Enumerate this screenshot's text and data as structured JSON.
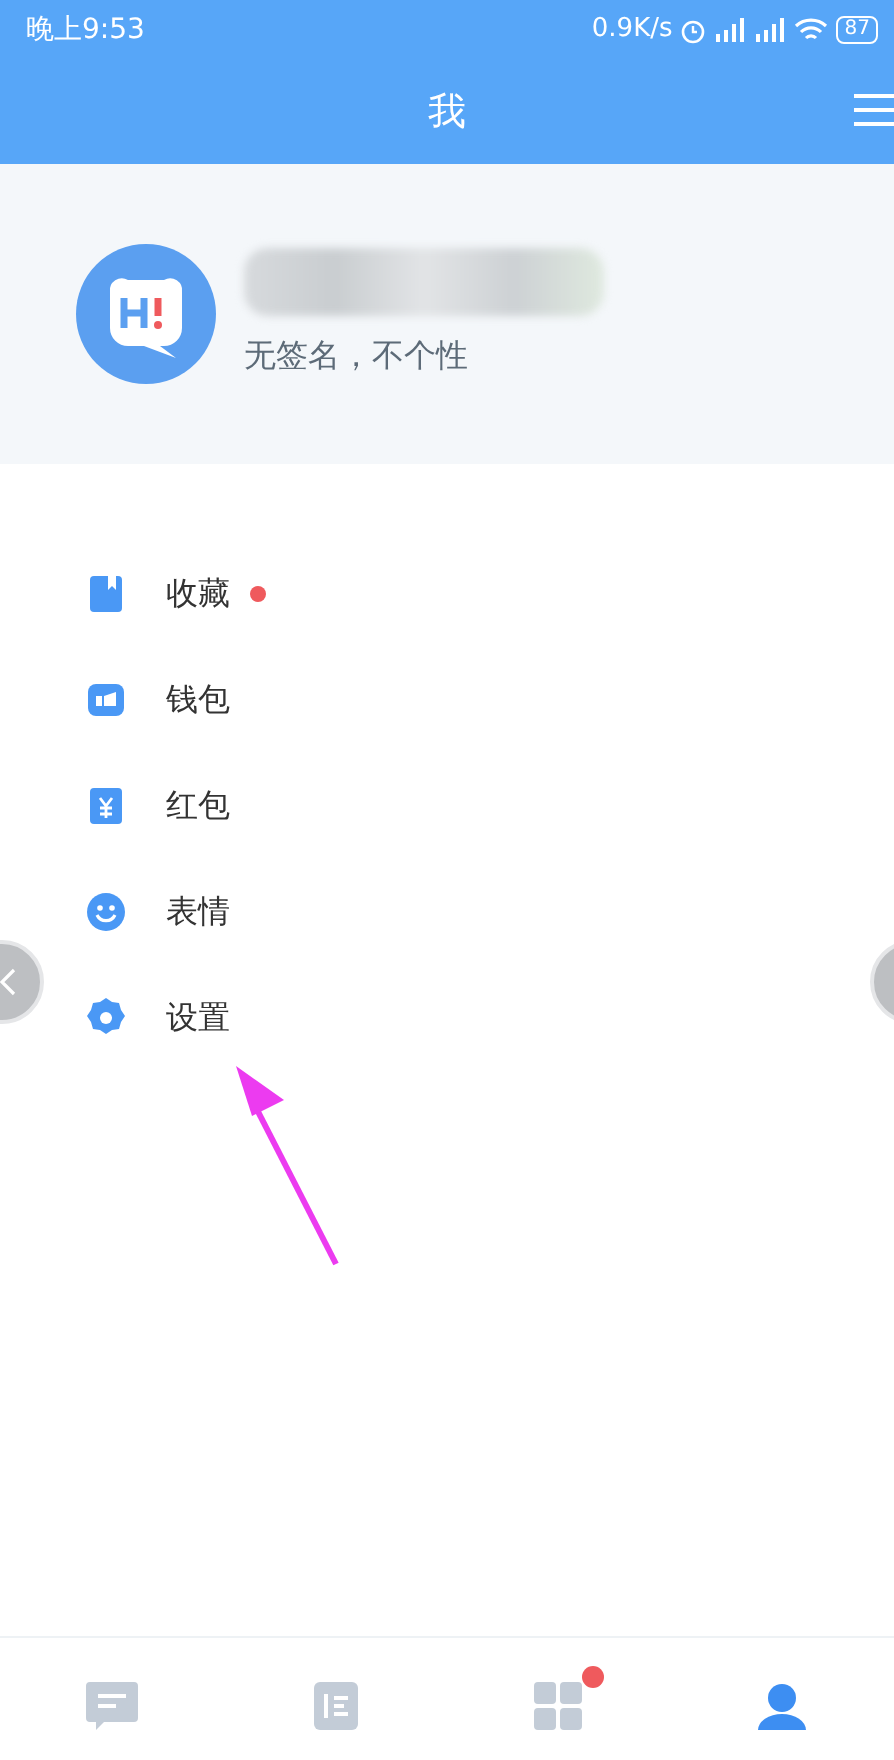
{
  "status_bar": {
    "time": "晚上9:53",
    "speed": "0.9K/s",
    "battery": "87"
  },
  "header": {
    "title": "我"
  },
  "profile": {
    "signature": "无签名，不个性"
  },
  "menu": [
    {
      "kind": "bookmark",
      "label": "收藏",
      "dot": true
    },
    {
      "kind": "wallet",
      "label": "钱包",
      "dot": false
    },
    {
      "kind": "redpacket",
      "label": "红包",
      "dot": false
    },
    {
      "kind": "smiley",
      "label": "表情",
      "dot": false
    },
    {
      "kind": "gear",
      "label": "设置",
      "dot": false
    }
  ],
  "tabs": [
    {
      "kind": "chat",
      "selected": false,
      "dot": false
    },
    {
      "kind": "list",
      "selected": false,
      "dot": false
    },
    {
      "kind": "apps",
      "selected": false,
      "dot": true
    },
    {
      "kind": "profile",
      "selected": true,
      "dot": false
    }
  ]
}
